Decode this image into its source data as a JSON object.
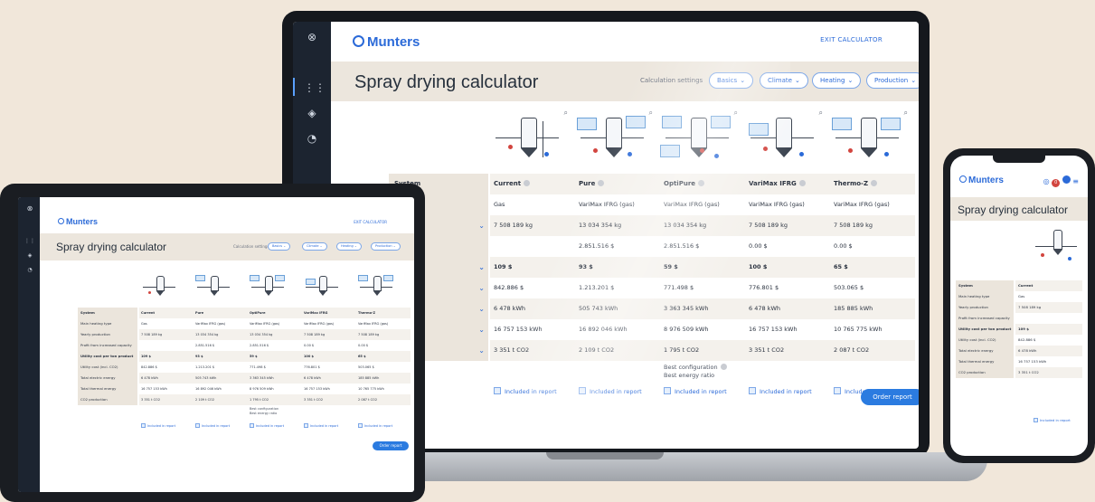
{
  "app": {
    "brand": "Munters",
    "exit_label": "EXIT CALCULATOR",
    "title": "Spray drying calculator",
    "settings_label": "Calculation settings",
    "chips": [
      "Basics",
      "Climate",
      "Heating",
      "Production"
    ],
    "order_label": "Order report",
    "include_label": "Included in report"
  },
  "table": {
    "row_labels": [
      "System",
      "Main heating type",
      "Yearly production",
      "Profit from increased capacity",
      "Utility cost per ton product",
      "Utility cost (incl. CO2)",
      "Total electric energy",
      "Total thermal energy",
      "CO2 production"
    ],
    "laptop_row_labels": [
      "System",
      "",
      "",
      "pacity",
      "ct",
      "",
      "",
      "",
      ""
    ],
    "columns": [
      {
        "name": "Current",
        "heating": "Gas",
        "production": "7 508 189 kg",
        "profit": "",
        "cost_per_ton": "109 $",
        "cost_incl": "842.886 $",
        "electric": "6 478 kWh",
        "thermal": "16 757 153 kWh",
        "co2": "3 351 t CO2"
      },
      {
        "name": "Pure",
        "heating": "VariMax IFRG (gas)",
        "production": "13 034 354 kg",
        "profit": "2.851.516 $",
        "cost_per_ton": "93 $",
        "cost_incl": "1.213.201 $",
        "electric": "505 743 kWh",
        "thermal": "16 892 046 kWh",
        "co2": "2 109 t CO2"
      },
      {
        "name": "OptiPure",
        "heating": "VariMax IFRG (gas)",
        "production": "13 034 354 kg",
        "profit": "2.851.516 $",
        "cost_per_ton": "59 $",
        "cost_incl": "771.498 $",
        "electric": "3 363 345 kWh",
        "thermal": "8 976 509 kWh",
        "co2": "1 795 t CO2"
      },
      {
        "name": "VariMax IFRG",
        "heating": "VariMax IFRG (gas)",
        "production": "7 508 189 kg",
        "profit": "0.00 $",
        "cost_per_ton": "100 $",
        "cost_incl": "776.801 $",
        "electric": "6 478 kWh",
        "thermal": "16 757 153 kWh",
        "co2": "3 351 t CO2"
      },
      {
        "name": "Thermo-Z",
        "heating": "VariMax IFRG (gas)",
        "production": "7 508 189 kg",
        "profit": "0.00 $",
        "cost_per_ton": "65 $",
        "cost_incl": "503.065 $",
        "electric": "185 885 kWh",
        "thermal": "10 765 775 kWh",
        "co2": "2 087 t CO2"
      }
    ],
    "best_config": "Best configuration",
    "best_ratio": "Best energy ratio"
  },
  "phone": {
    "notif_count": "0",
    "current": "Current",
    "values": [
      "Current",
      "Gas",
      "7 508 189 kg",
      "",
      "109 $",
      "842.886 $",
      "6 478 kWh",
      "16 757 153 kWh",
      "3 351 t CO2"
    ]
  },
  "colors": {
    "accent": "#2b6ad8",
    "beige": "#ece6dd",
    "background": "#f1e7da",
    "sidebar": "#1c2430"
  }
}
